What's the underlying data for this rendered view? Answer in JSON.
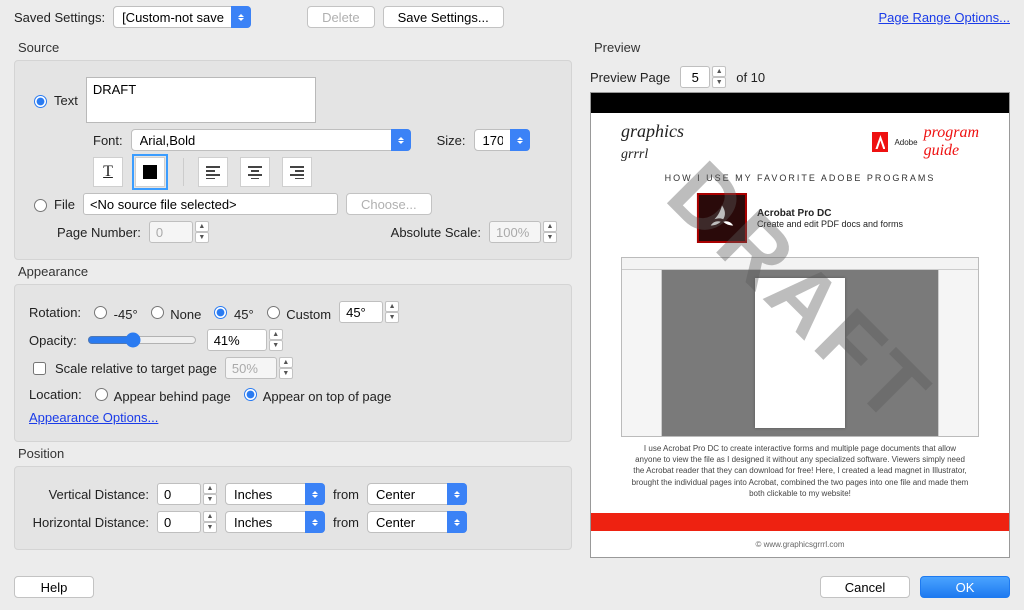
{
  "topbar": {
    "saved_settings_label": "Saved Settings:",
    "saved_settings_value": "[Custom-not saved]",
    "delete_label": "Delete",
    "save_settings_label": "Save Settings...",
    "page_range_link": "Page Range Options..."
  },
  "source": {
    "title": "Source",
    "text_radio": "Text",
    "draft_text": "DRAFT",
    "font_label": "Font:",
    "font_value": "Arial,Bold",
    "size_label": "Size:",
    "size_value": "170",
    "file_radio": "File",
    "file_value": "<No source file selected>",
    "choose_label": "Choose...",
    "page_number_label": "Page Number:",
    "page_number_value": "0",
    "abs_scale_label": "Absolute Scale:",
    "abs_scale_value": "100%"
  },
  "appearance": {
    "title": "Appearance",
    "rotation_label": "Rotation:",
    "rot_m45": "-45°",
    "rot_none": "None",
    "rot_45": "45°",
    "rot_custom": "Custom",
    "rot_custom_value": "45°",
    "opacity_label": "Opacity:",
    "opacity_value": "41%",
    "scale_relative_label": "Scale relative to target page",
    "scale_relative_value": "50%",
    "location_label": "Location:",
    "loc_behind": "Appear behind page",
    "loc_ontop": "Appear on top of page",
    "appearance_options_link": "Appearance Options..."
  },
  "position": {
    "title": "Position",
    "vert_label": "Vertical Distance:",
    "horiz_label": "Horizontal Distance:",
    "vert_value": "0",
    "horiz_value": "0",
    "vert_unit": "Inches",
    "horiz_unit": "Inches",
    "from_label": "from",
    "vert_from": "Center",
    "horiz_from": "Center"
  },
  "preview": {
    "title": "Preview",
    "preview_page_label": "Preview Page",
    "page_value": "5",
    "of_label": "of 10",
    "watermark": "DRAFT",
    "subhead": "HOW I USE MY FAVORITE ADOBE PROGRAMS",
    "app_name": "Acrobat Pro DC",
    "app_desc": "Create and edit PDF docs and forms",
    "body_text": "I use Acrobat Pro DC to create interactive forms and multiple page documents that allow anyone to view the file as I designed it without any specialized software. Viewers simply need the Acrobat reader that they can download for free! Here, I created a lead magnet in Illustrator, brought the individual pages into Acrobat, combined the two pages into one file and made them both clickable to my website!",
    "footer": "© www.graphicsgrrrl.com",
    "gg": "graphics",
    "gg2": "grrrl",
    "adobe_label": "Adobe",
    "program": "program",
    "guide": "guide"
  },
  "buttons": {
    "help": "Help",
    "cancel": "Cancel",
    "ok": "OK"
  }
}
